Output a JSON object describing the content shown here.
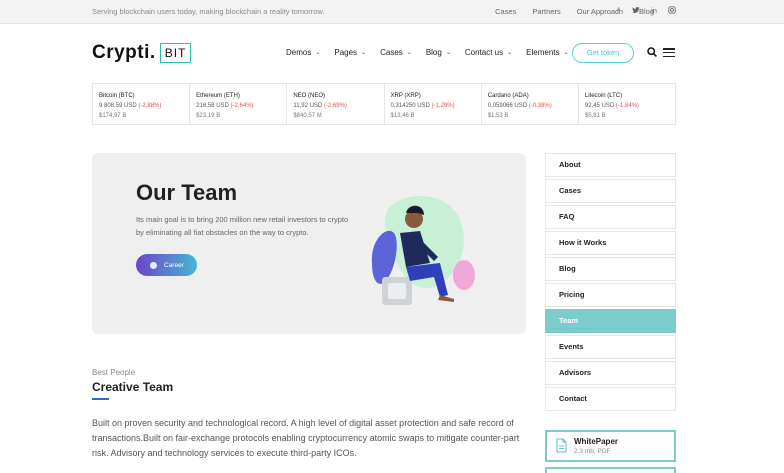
{
  "topbar": {
    "tagline": "Serving blockchain users today, making blockchain a reality tomorrow.",
    "links": [
      "Cases",
      "Partners",
      "Our Approach",
      "Blog"
    ],
    "socials": [
      "facebook-icon",
      "twitter-icon",
      "linkedin-icon",
      "instagram-icon"
    ]
  },
  "logo": {
    "word": "Crypti.",
    "box": "BIT"
  },
  "nav": {
    "items": [
      "Demos",
      "Pages",
      "Cases",
      "Blog",
      "Contact us",
      "Elements"
    ],
    "cta": "Get token"
  },
  "ticker": [
    {
      "name": "Bitcoin (BTC)",
      "price": "9 808,59 USD",
      "change": "(-2,88%)",
      "cap": "$174,97 B"
    },
    {
      "name": "Ethereum (ETH)",
      "price": "216,58 USD",
      "change": "(-2,64%)",
      "cap": "$23,19 B"
    },
    {
      "name": "NEO (NEO)",
      "price": "11,92 USD",
      "change": "(-2,69%)",
      "cap": "$840,57 M"
    },
    {
      "name": "XRP (XRP)",
      "price": "0,314250 USD",
      "change": "(-1,29%)",
      "cap": "$13,46 B"
    },
    {
      "name": "Cardano (ADA)",
      "price": "0,059066 USD",
      "change": "(-0,38%)",
      "cap": "$1,53 B"
    },
    {
      "name": "Litecoin (LTC)",
      "price": "92,45 USD",
      "change": "(-1,84%)",
      "cap": "$5,81 B"
    }
  ],
  "hero": {
    "title": "Our Team",
    "text": "Its main goal is to bring 200 million new retail investors to crypto by eliminating all fiat obstacles on the way to crypto.",
    "button": "Career"
  },
  "section": {
    "subtitle": "Best People",
    "title": "Creative Team",
    "body": "Built on proven security and technological record. A high level of digital asset protection and safe record of transactions.Built on fair-exchange protocols enabling cryptocurrency atomic swaps to mitigate counter-part risk. Advisory and technology services to execute third-party ICOs."
  },
  "sidebar": {
    "items": [
      "About",
      "Cases",
      "FAQ",
      "How it Works",
      "Blog",
      "Pricing",
      "Team",
      "Events",
      "Advisors",
      "Contact"
    ],
    "active": "Team"
  },
  "document": {
    "title": "WhitePaper",
    "meta": "2.3 mb, PDF"
  },
  "colors": {
    "accent": "#7ccccd",
    "teal": "#2fbfa9",
    "negative": "#e0524a",
    "button_start": "#6b45c8",
    "button_end": "#46b6d4"
  }
}
